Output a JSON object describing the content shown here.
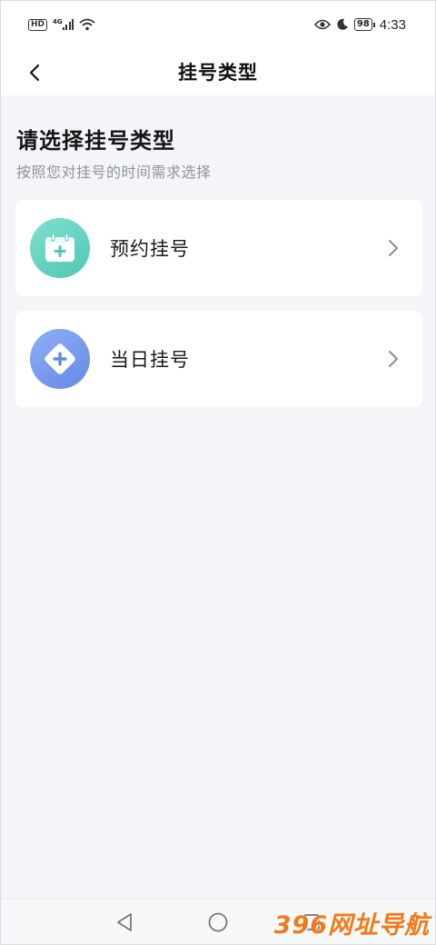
{
  "status_bar": {
    "hd": "HD",
    "network": "4G",
    "battery": "98",
    "time": "4:33"
  },
  "nav": {
    "title": "挂号类型"
  },
  "content": {
    "heading": "请选择挂号类型",
    "subheading": "按照您对挂号的时间需求选择",
    "options": [
      {
        "label": "预约挂号",
        "icon": "calendar-add-icon",
        "color": "#5ccbb8"
      },
      {
        "label": "当日挂号",
        "icon": "diamond-plus-icon",
        "color": "#7398ec"
      }
    ]
  },
  "watermark": "396网址导航"
}
